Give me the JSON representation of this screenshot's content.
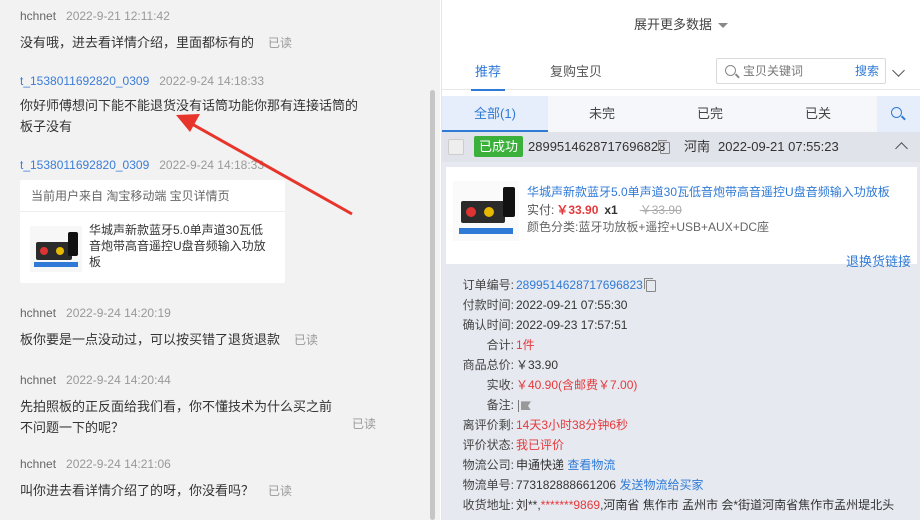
{
  "chat": {
    "messages": [
      {
        "sender": "hchnet",
        "time": "2022-9-21 12:11:42",
        "text": "没有哦，进去看详情介绍，里面都标有的",
        "status": "已读"
      },
      {
        "sender": "t_1538011692820_0309",
        "time": "2022-9-24 14:18:33",
        "text": "你好师傅想问下能不能退货没有话筒功能你那有连接话筒的板子没有"
      },
      {
        "sender": "t_1538011692820_0309",
        "time": "2022-9-24 14:18:33"
      },
      {
        "sender": "hchnet",
        "time": "2022-9-24 14:20:19",
        "text": "板你要是一点没动过，可以按买错了退货退款",
        "status": "已读"
      },
      {
        "sender": "hchnet",
        "time": "2022-9-24 14:20:44",
        "text": "先拍照板的正反面给我们看，你不懂技术为什么买之前不问题一下的呢？",
        "status": "已读"
      },
      {
        "sender": "hchnet",
        "time": "2022-9-24 14:21:06",
        "text": "叫你进去看详情介绍了的呀，你没看吗？",
        "status": "已读"
      }
    ],
    "card": {
      "source": "当前用户来自 淘宝移动端 宝贝详情页",
      "title": "华城声新款蓝牙5.0单声道30瓦低音炮带高音遥控U盘音频输入功放板"
    }
  },
  "panel": {
    "expand_label": "展开更多数据",
    "tabs": [
      "推荐",
      "复购宝贝"
    ],
    "search": {
      "placeholder": "宝贝关键词",
      "button": "搜索"
    },
    "subtabs": [
      "全部(1)",
      "未完",
      "已完",
      "已关"
    ],
    "order": {
      "status": "已成功",
      "id": "2899514628717696823",
      "region": "河南",
      "time": "2022-09-21 07:55:23",
      "product": {
        "title": "华城声新款蓝牙5.0单声道30瓦低音炮带高音遥控U盘音频输入功放板",
        "paid_label": "实付:",
        "price": "￥33.90",
        "qty": "x1",
        "orig_price": "￥33.90",
        "spec": "颜色分类:蓝牙功放板+遥控+USB+AUX+DC座",
        "refund_link": "退换货链接"
      },
      "details": [
        {
          "label": "订单编号:",
          "value": "2899514628717696823"
        },
        {
          "label": "付款时间:",
          "value": "2022-09-21 07:55:30"
        },
        {
          "label": "确认时间:",
          "value": "2022-09-23 17:57:51"
        },
        {
          "label": "合计:",
          "value": "1件"
        },
        {
          "label": "商品总价:",
          "value": "￥33.90"
        },
        {
          "label": "实收:",
          "value": "￥40.90(含邮费￥7.00)"
        },
        {
          "label": "备注:",
          "value": ""
        },
        {
          "label": "离评价剩:",
          "value": "14天3小时38分钟6秒"
        },
        {
          "label": "评价状态:",
          "value": "我已评价"
        },
        {
          "label": "物流公司:",
          "value": "申通快递",
          "link": "查看物流"
        },
        {
          "label": "物流单号:",
          "value": "773182888661206",
          "link": "发送物流给买家"
        },
        {
          "label": "收货地址:",
          "value_a": "刘**,",
          "value_b": "*******9869",
          "value_c": ",河南省 焦作市 孟州市 会*街道河南省焦作市孟州堤北头"
        }
      ]
    }
  },
  "colors": {
    "accent": "#2f7ad6",
    "success": "#3bb03b",
    "price": "#e4393c",
    "annotation_arrow": "#e8352b"
  }
}
